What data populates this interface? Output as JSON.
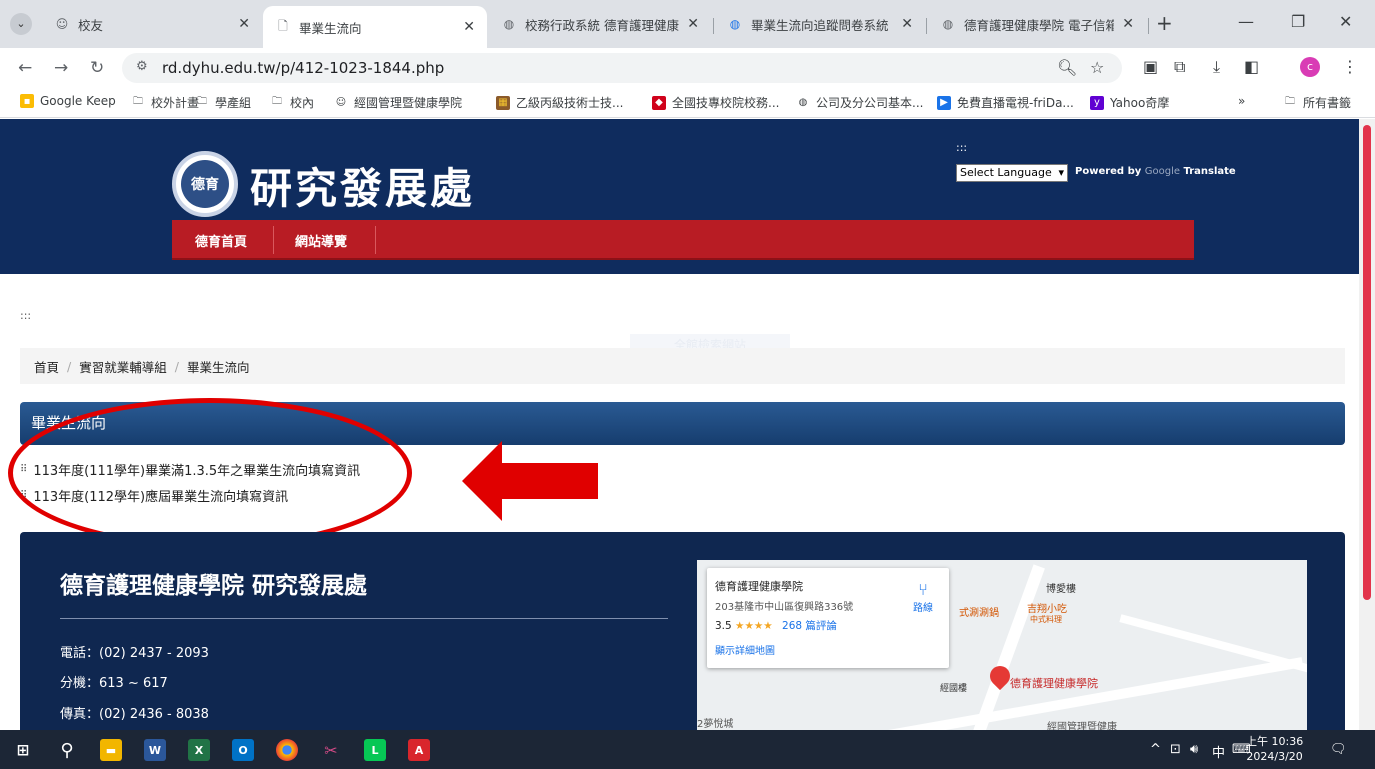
{
  "browser": {
    "tabs": [
      {
        "label": "校友",
        "icon": "smiley-icon"
      },
      {
        "label": "畢業生流向",
        "icon": "page-icon",
        "active": true
      },
      {
        "label": "校務行政系統 德育護理健康",
        "icon": "globe-icon"
      },
      {
        "label": "畢業生流向追蹤問卷系統",
        "icon": "globe-icon"
      },
      {
        "label": "德育護理健康學院 電子信箱",
        "icon": "globe-icon"
      }
    ],
    "url": "rd.dyhu.edu.tw/p/412-1023-1844.php",
    "profile_initial": "c",
    "bookmarks": [
      "Google Keep",
      "校外計畫",
      "學產組",
      "校內",
      "經國管理暨健康學院",
      "乙級丙級技術士技...",
      "全國技專校院校務...",
      "公司及分公司基本...",
      "免費直播電視-friDa...",
      "Yahoo奇摩"
    ],
    "bookmarks_more": "»",
    "all_bookmarks": "所有書籤"
  },
  "site": {
    "title": "研究發展處",
    "logo_text": "德育",
    "nav": [
      "德育首頁",
      "網站導覽"
    ],
    "lang_dots": ":::",
    "lang_select": "Select Language",
    "powered_by": "Powered by",
    "powered_google": "Google",
    "powered_translate": "Translate",
    "acc_dots": ":::",
    "ghost_button": "全館檢索網站"
  },
  "breadcrumb": [
    "首頁",
    "實習就業輔導組",
    "畢業生流向"
  ],
  "section": {
    "heading": "畢業生流向",
    "items": [
      "113年度(111學年)畢業滿1.3.5年之畢業生流向填寫資訊",
      "113年度(112學年)應屆畢業生流向填寫資訊"
    ]
  },
  "footer": {
    "title": "德育護理健康學院 研究發展處",
    "phone": "電話：(02) 2437 - 2093",
    "ext": "分機：613 ~ 617",
    "fax": "傳真：(02) 2436 - 8038"
  },
  "map": {
    "place_name": "德育護理健康學院",
    "address": "203基隆市中山區復興路336號",
    "rating": "3.5",
    "stars": "★★★★",
    "reviews": "268 篇評論",
    "view_larger": "顯示詳細地圖",
    "directions": "路線",
    "labels": [
      "博愛樓",
      "吉翔小吃",
      "中式料理",
      "經國樓",
      "德育護理健康學院",
      "經國管理暨健康",
      "2夢悅城",
      "式涮涮鍋"
    ]
  },
  "taskbar": {
    "time": "上午 10:36",
    "date": "2024/3/20"
  }
}
